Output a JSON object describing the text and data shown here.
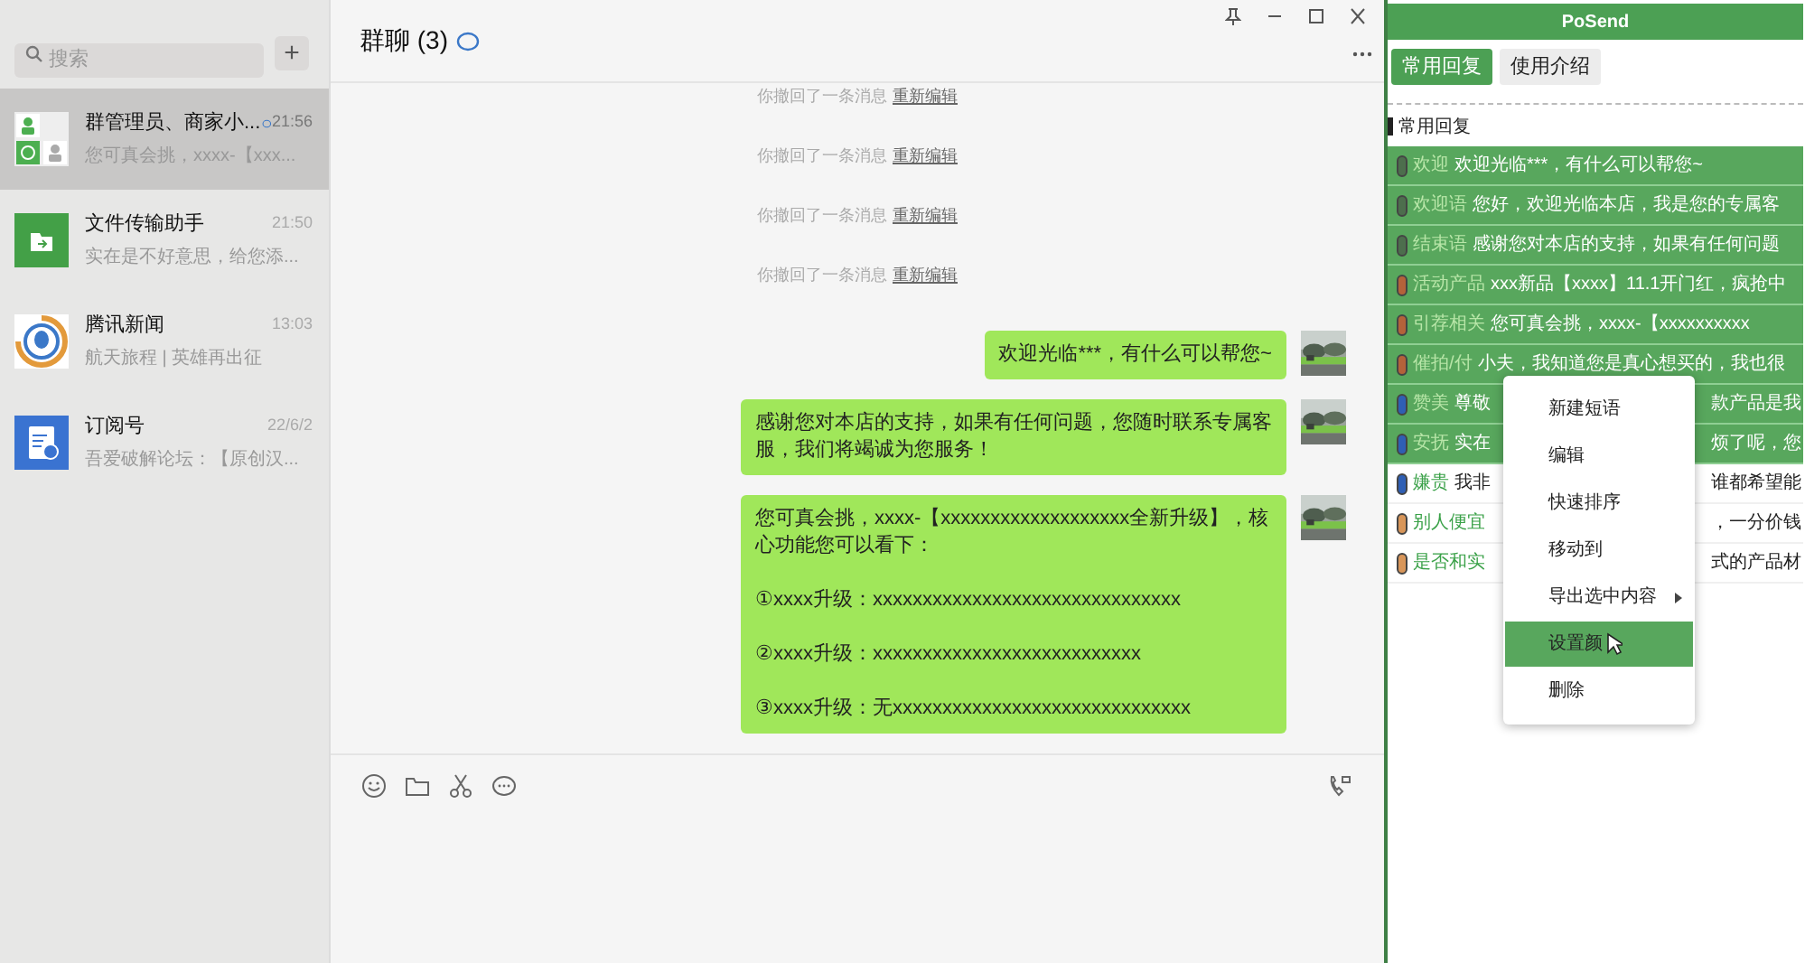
{
  "sidebar": {
    "search": {
      "placeholder": "搜索"
    },
    "add_button": "+",
    "chats": [
      {
        "kind": "group",
        "name": "群管理员、商家小...",
        "time": "21:56",
        "preview": "您可真会挑，xxxx-【xxx...",
        "selected": true,
        "badge": true
      },
      {
        "kind": "file",
        "name": "文件传输助手",
        "time": "21:50",
        "preview": "实在是不好意思，给您添...",
        "selected": false,
        "badge": false
      },
      {
        "kind": "news",
        "name": "腾讯新闻",
        "time": "13:03",
        "preview": "航天旅程 | 英雄再出征",
        "selected": false,
        "badge": false
      },
      {
        "kind": "subscription",
        "name": "订阅号",
        "time": "22/6/2",
        "preview": "吾爱破解论坛：【原创汉...",
        "selected": false,
        "badge": false
      }
    ]
  },
  "chat": {
    "title": "群聊 (3)",
    "messages": [
      {
        "kind": "recall",
        "text": "你撤回了一条消息",
        "link": "重新编辑"
      },
      {
        "kind": "recall",
        "text": "你撤回了一条消息",
        "link": "重新编辑"
      },
      {
        "kind": "recall",
        "text": "你撤回了一条消息",
        "link": "重新编辑"
      },
      {
        "kind": "recall",
        "text": "你撤回了一条消息",
        "link": "重新编辑"
      },
      {
        "kind": "bubble",
        "text": "欢迎光临***，有什么可以帮您~"
      },
      {
        "kind": "bubble",
        "text": "感谢您对本店的支持，如果有任何问题，您随时联系专属客服，我们将竭诚为您服务！"
      },
      {
        "kind": "bubble",
        "text": "您可真会挑，xxxx-【xxxxxxxxxxxxxxxxxxx全新升级】，核心功能您可以看下：\n\n①xxxx升级：xxxxxxxxxxxxxxxxxxxxxxxxxxxxxxx\n\n②xxxx升级：xxxxxxxxxxxxxxxxxxxxxxxxxxx\n\n③xxxx升级：无xxxxxxxxxxxxxxxxxxxxxxxxxxxxxx"
      }
    ]
  },
  "panel": {
    "title": "PoSend",
    "tabs": [
      {
        "label": "常用回复",
        "selected": true
      },
      {
        "label": "使用介绍",
        "selected": false
      }
    ],
    "section": "常用回复",
    "replies": [
      {
        "tag": "欢迎",
        "text": "欢迎光临***，有什么可以帮您~",
        "color": "#4d6e4d",
        "selected": true
      },
      {
        "tag": "欢迎语",
        "text": "您好，欢迎光临本店，我是您的专属客",
        "color": "#4d6e4d",
        "selected": true
      },
      {
        "tag": "结束语",
        "text": "感谢您对本店的支持，如果有任何问题",
        "color": "#4d6e4d",
        "selected": true
      },
      {
        "tag": "活动产品",
        "text": "xxx新品【xxxx】11.1开门红，疯抢中",
        "color": "#b4623a",
        "selected": true
      },
      {
        "tag": "引荐相关",
        "text": "您可真会挑，xxxx-【xxxxxxxxxx",
        "color": "#b4623a",
        "selected": true
      },
      {
        "tag": "催拍/付",
        "text": "小夫，我知道您是真心想买的，我也很",
        "color": "#b4623a",
        "selected": true
      },
      {
        "tag": "赞美",
        "text": "尊敬",
        "tail": "款产品是我",
        "color": "#2f5fb4",
        "selected": true
      },
      {
        "tag": "安抚",
        "text": "实在",
        "tail": "烦了呢，您",
        "color": "#2f5fb4",
        "selected": true
      },
      {
        "tag": "嫌贵",
        "text": "我非",
        "tail": "谁都希望能",
        "color": "#2f5fb4",
        "selected": false
      },
      {
        "tag": "别人便宜",
        "tail": "，一分价钱",
        "color": "#d8965a",
        "selected": false
      },
      {
        "tag": "是否和实",
        "tail": "式的产品材",
        "color": "#d8965a",
        "selected": false
      }
    ]
  },
  "context_menu": [
    {
      "label": "新建短语",
      "selected": false,
      "submenu": false
    },
    {
      "label": "编辑",
      "selected": false,
      "submenu": false
    },
    {
      "label": "快速排序",
      "selected": false,
      "submenu": false
    },
    {
      "label": "移动到",
      "selected": false,
      "submenu": false
    },
    {
      "label": "导出选中内容",
      "selected": false,
      "submenu": true
    },
    {
      "label": "设置颜",
      "selected": true,
      "submenu": false
    },
    {
      "label": "删除",
      "selected": false,
      "submenu": false
    }
  ]
}
